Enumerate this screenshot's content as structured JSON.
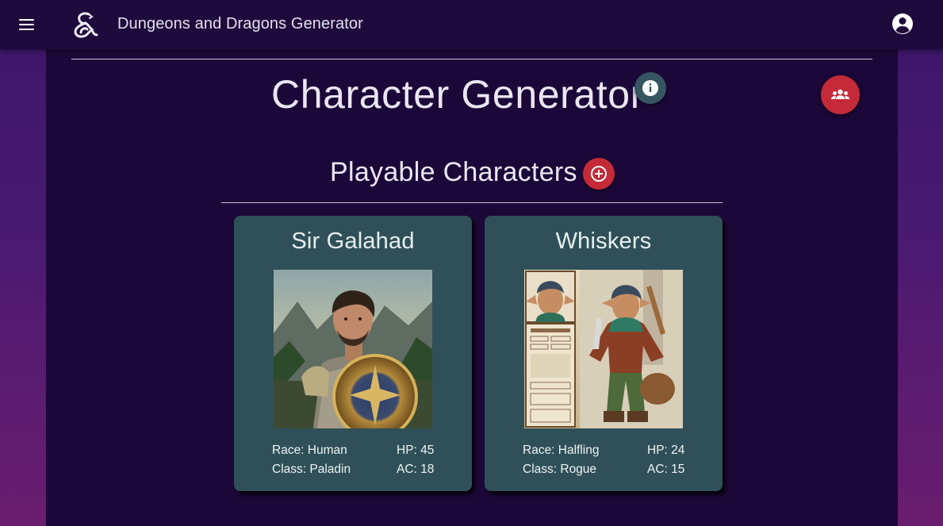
{
  "app": {
    "title": "Dungeons and Dragons Generator",
    "menu_icon": "menu-icon",
    "logo_icon": "dnd-ampersand-logo",
    "account_icon": "account-circle-icon"
  },
  "page": {
    "title": "Character Generator",
    "info_icon": "info-icon",
    "party_icon": "groups-icon"
  },
  "section": {
    "title": "Playable Characters",
    "add_icon": "add-circle-icon"
  },
  "characters": [
    {
      "name": "Sir Galahad",
      "race": "Race: Human",
      "class": "Class: Paladin",
      "hp": "HP: 45",
      "ac": "AC: 18"
    },
    {
      "name": "Whiskers",
      "race": "Race: Halfling",
      "class": "Class: Rogue",
      "hp": "HP: 24",
      "ac": "AC: 15"
    }
  ],
  "colors": {
    "appbar": "#1f0a3c",
    "panel": "#1c0838",
    "card": "#2f5058",
    "accent_red": "#c42a37",
    "info_button": "#365563"
  }
}
